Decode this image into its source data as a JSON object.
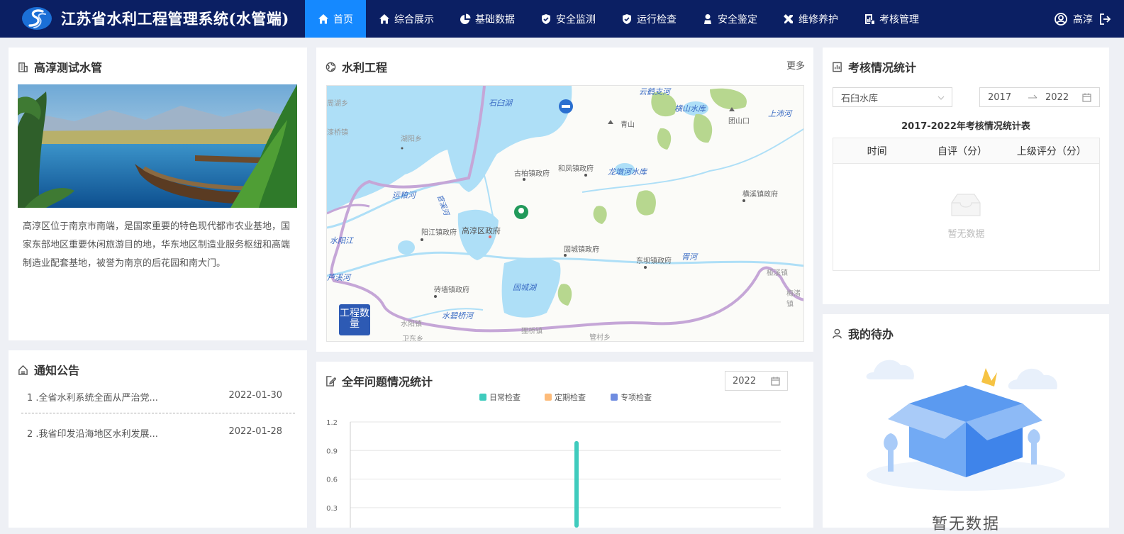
{
  "header": {
    "title": "江苏省水利工程管理系统(水管端)",
    "nav": [
      {
        "label": "首页",
        "icon": "home-icon",
        "active": true
      },
      {
        "label": "综合展示",
        "icon": "home-icon"
      },
      {
        "label": "基础数据",
        "icon": "pie-chart-icon"
      },
      {
        "label": "安全监测",
        "icon": "shield-icon"
      },
      {
        "label": "运行检查",
        "icon": "shield-check-icon"
      },
      {
        "label": "安全鉴定",
        "icon": "person-icon"
      },
      {
        "label": "维修养护",
        "icon": "tools-icon"
      },
      {
        "label": "考核管理",
        "icon": "chart-doc-icon"
      }
    ],
    "user": "高淳"
  },
  "intro": {
    "title": "高淳测试水管",
    "text": "高淳区位于南京市南端，是国家重要的特色现代都市农业基地，国家东部地区重要休闲旅游目的地，华东地区制造业服务枢纽和高端制造业配套基地，被誉为南京的后花园和南大门。"
  },
  "notice": {
    "title": "通知公告",
    "items": [
      {
        "text": "1 .全省水利系统全面从严治党...",
        "date": "2022-01-30"
      },
      {
        "text": "2 .我省印发沿海地区水利发展...",
        "date": "2022-01-28"
      }
    ]
  },
  "map": {
    "title": "水利工程",
    "more": "更多",
    "count_button": "工程数量",
    "labels": [
      {
        "text": "石臼湖",
        "style": "water"
      },
      {
        "text": "湖阳乡",
        "style": "place"
      },
      {
        "text": "古柏镇政府",
        "style": "place"
      },
      {
        "text": "和凤镇政府",
        "style": "place"
      },
      {
        "text": "龙墩河水库",
        "style": "water"
      },
      {
        "text": "横溪镇政府",
        "style": "place"
      },
      {
        "text": "阳江镇政府",
        "style": "place"
      },
      {
        "text": "高淳区政府",
        "style": "place"
      },
      {
        "text": "固城镇政府",
        "style": "place"
      },
      {
        "text": "东坝镇政府",
        "style": "place"
      },
      {
        "text": "砖墙镇政府",
        "style": "place"
      },
      {
        "text": "固城湖",
        "style": "water"
      },
      {
        "text": "水碧桥河",
        "style": "water"
      },
      {
        "text": "官溪河",
        "style": "water"
      },
      {
        "text": "胥河",
        "style": "water"
      },
      {
        "text": "水阳江",
        "style": "water"
      },
      {
        "text": "运粮河",
        "style": "water"
      },
      {
        "text": "漆桥镇",
        "style": "place"
      },
      {
        "text": "桠溪镇",
        "style": "place"
      },
      {
        "text": "青山",
        "style": "place"
      },
      {
        "text": "团山口",
        "style": "place"
      },
      {
        "text": "上沛河",
        "style": "water"
      },
      {
        "text": "横山水库",
        "style": "water"
      },
      {
        "text": "水阳镇",
        "style": "place"
      },
      {
        "text": "卫东乡",
        "style": "place"
      },
      {
        "text": "狸桥镇",
        "style": "place"
      },
      {
        "text": "管村乡",
        "style": "place"
      },
      {
        "text": "周湖乡",
        "style": "place"
      },
      {
        "text": "梅渚镇",
        "style": "place"
      },
      {
        "text": "芦溪河",
        "style": "water"
      },
      {
        "text": "云鹤支河",
        "style": "water"
      }
    ]
  },
  "issue_stats": {
    "title": "全年问题情况统计",
    "year": "2022",
    "chart_data": {
      "type": "bar",
      "series": [
        {
          "name": "日常检查",
          "color": "#3fcbbd"
        },
        {
          "name": "定期检查",
          "color": "#fdbb7a"
        },
        {
          "name": "专项检查",
          "color": "#6f8ce0"
        }
      ],
      "y_ticks": [
        "1.2",
        "0.9",
        "0.6",
        "0.3"
      ],
      "ylim": [
        0,
        1.2
      ],
      "bar": {
        "series": "日常检查",
        "value": 1
      }
    }
  },
  "assess": {
    "title": "考核情况统计",
    "select": "石臼水库",
    "range_start": "2017",
    "range_end": "2022",
    "table_title": "2017-2022年考核情况统计表",
    "columns": [
      "时间",
      "自评（分）",
      "上级评分（分）"
    ],
    "empty": "暂无数据"
  },
  "todo": {
    "title": "我的待办",
    "empty": "暂无数据"
  }
}
